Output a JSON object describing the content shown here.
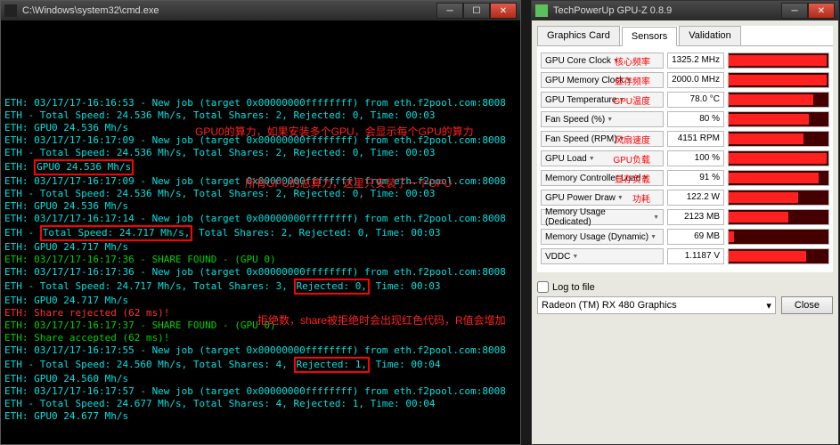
{
  "cmd": {
    "title": "C:\\Windows\\system32\\cmd.exe",
    "lines": [
      {
        "t": "ETH: 03/17/17-16:16:53 - New job (target 0x00000000ffffffff) from eth.f2pool.com:8008",
        "c": "cyan"
      },
      {
        "t": "ETH - Total Speed: 24.536 Mh/s, Total Shares: 2, Rejected: 0, Time: 00:03",
        "c": "cyan"
      },
      {
        "t": "ETH: GPU0 24.536 Mh/s",
        "c": "cyan"
      },
      {
        "t": "ETH: 03/17/17-16:17:09 - New job (target 0x00000000ffffffff) from eth.f2pool.com:8008",
        "c": "cyan"
      },
      {
        "t": "ETH - Total Speed: 24.536 Mh/s, Total Shares: 2, Rejected: 0, Time: 00:03",
        "c": "cyan"
      },
      {
        "t": "ETH: ",
        "c": "cyan",
        "box": "GPU0 24.536 Mh/s",
        "after": ""
      },
      {
        "t": "ETH: 03/17/17-16:17:09 - New job (target 0x00000000ffffffff) from eth.f2pool.com:8008",
        "c": "cyan"
      },
      {
        "t": "ETH - Total Speed: 24.536 Mh/s, Total Shares: 2, Rejected: 0, Time: 00:03",
        "c": "cyan"
      },
      {
        "t": "ETH: GPU0 24.536 Mh/s",
        "c": "cyan"
      },
      {
        "t": "ETH: 03/17/17-16:17:14 - New job (target 0x00000000ffffffff) from eth.f2pool.com:8008",
        "c": "cyan"
      },
      {
        "t": "ETH - ",
        "c": "cyan",
        "box": "Total Speed: 24.717 Mh/s,",
        "after": " Total Shares: 2, Rejected: 0, Time: 00:03"
      },
      {
        "t": "ETH: GPU0 24.717 Mh/s",
        "c": "cyan"
      },
      {
        "t": "ETH: 03/17/17-16:17:36 - SHARE FOUND - (GPU 0)",
        "c": "green"
      },
      {
        "t": "ETH: 03/17/17-16:17:36 - New job (target 0x00000000ffffffff) from eth.f2pool.com:8008",
        "c": "cyan"
      },
      {
        "t": "ETH - Total Speed: 24.717 Mh/s, Total Shares: 3, ",
        "c": "cyan",
        "box": "Rejected: 0,",
        "after": " Time: 00:03"
      },
      {
        "t": "ETH: GPU0 24.717 Mh/s",
        "c": "cyan"
      },
      {
        "t": "ETH: Share rejected (62 ms)!",
        "c": "red"
      },
      {
        "t": "ETH: 03/17/17-16:17:37 - SHARE FOUND - (GPU 0)",
        "c": "green"
      },
      {
        "t": "ETH: Share accepted (62 ms)!",
        "c": "green"
      },
      {
        "t": "ETH: 03/17/17-16:17:55 - New job (target 0x00000000ffffffff) from eth.f2pool.com:8008",
        "c": "cyan"
      },
      {
        "t": "ETH - Total Speed: 24.560 Mh/s, Total Shares: 4, ",
        "c": "cyan",
        "box": "Rejected: 1,",
        "after": " Time: 00:04"
      },
      {
        "t": "ETH: GPU0 24.560 Mh/s",
        "c": "cyan"
      },
      {
        "t": "ETH: 03/17/17-16:17:57 - New job (target 0x00000000ffffffff) from eth.f2pool.com:8008",
        "c": "cyan"
      },
      {
        "t": "ETH - Total Speed: 24.677 Mh/s, Total Shares: 4, Rejected: 1, Time: 00:04",
        "c": "cyan"
      },
      {
        "t": "ETH: GPU0 24.677 Mh/s",
        "c": "cyan"
      }
    ],
    "annotations": {
      "a1": "GPU0的算力，如果安装多个GPU，会显示每个GPU的算力",
      "a2": "所有GPU的总算力，这里只安装了一个GPU",
      "a3": "拒绝数，share被拒绝时会出现红色代码，R值会增加"
    }
  },
  "gpuz": {
    "title": "TechPowerUp GPU-Z 0.8.9",
    "tabs": [
      "Graphics Card",
      "Sensors",
      "Validation"
    ],
    "active_tab": "Sensors",
    "sensors": [
      {
        "label": "GPU Core Clock",
        "ann": "核心频率",
        "value": "1325.2 MHz",
        "fill": 98
      },
      {
        "label": "GPU Memory Clock",
        "ann": "显存频率",
        "value": "2000.0 MHz",
        "fill": 98
      },
      {
        "label": "GPU Temperature",
        "ann": "GPU温度",
        "value": "78.0 °C",
        "fill": 85
      },
      {
        "label": "Fan Speed (%)",
        "ann": "",
        "value": "80 %",
        "fill": 80
      },
      {
        "label": "Fan Speed (RPM)",
        "ann": "风扇速度",
        "value": "4151 RPM",
        "fill": 75
      },
      {
        "label": "GPU Load",
        "ann": "GPU负载",
        "value": "100 %",
        "fill": 98
      },
      {
        "label": "Memory Controller Load",
        "ann": "显存负载",
        "value": "91 %",
        "fill": 90
      },
      {
        "label": "GPU Power Draw",
        "ann": "功耗",
        "value": "122.2 W",
        "fill": 70
      },
      {
        "label": "Memory Usage (Dedicated)",
        "ann": "",
        "value": "2123 MB",
        "fill": 60
      },
      {
        "label": "Memory Usage (Dynamic)",
        "ann": "",
        "value": "69 MB",
        "fill": 5
      },
      {
        "label": "VDDC",
        "ann": "",
        "value": "1.1187 V",
        "fill": 78
      }
    ],
    "log_label": "Log to file",
    "gpu_select": "Radeon (TM) RX 480 Graphics",
    "close_btn": "Close"
  }
}
